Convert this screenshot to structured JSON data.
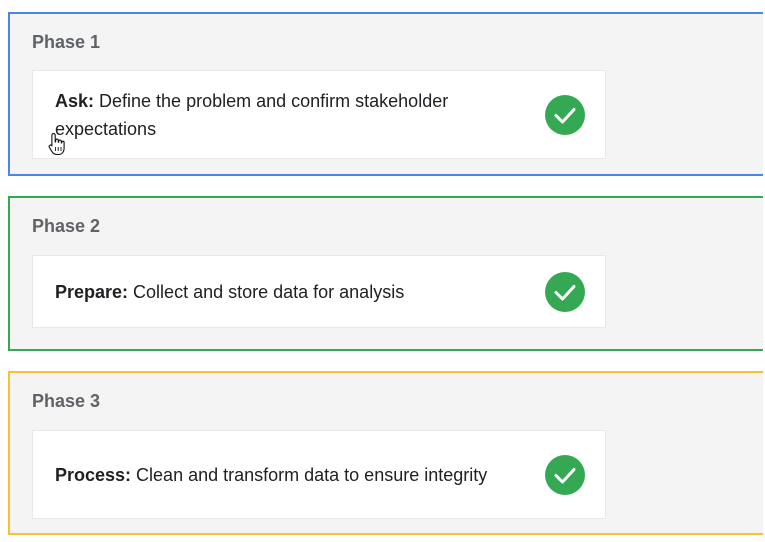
{
  "colors": {
    "phase_1_border": "#4a86e8",
    "phase_2_border": "#34a853",
    "phase_3_border": "#f4c430",
    "check_fill": "#34a853",
    "check_mark": "#ffffff"
  },
  "phases": [
    {
      "label": "Phase 1",
      "term": "Ask:",
      "description": " Define the problem and confirm stakeholder expectations",
      "status_icon": "check-circle-icon"
    },
    {
      "label": "Phase 2",
      "term": "Prepare:",
      "description": " Collect and store data for analysis",
      "status_icon": "check-circle-icon"
    },
    {
      "label": "Phase 3",
      "term": "Process:",
      "description": " Clean and transform data to ensure integrity",
      "status_icon": "check-circle-icon"
    }
  ],
  "cursor": {
    "icon": "hand-pointer-icon"
  }
}
